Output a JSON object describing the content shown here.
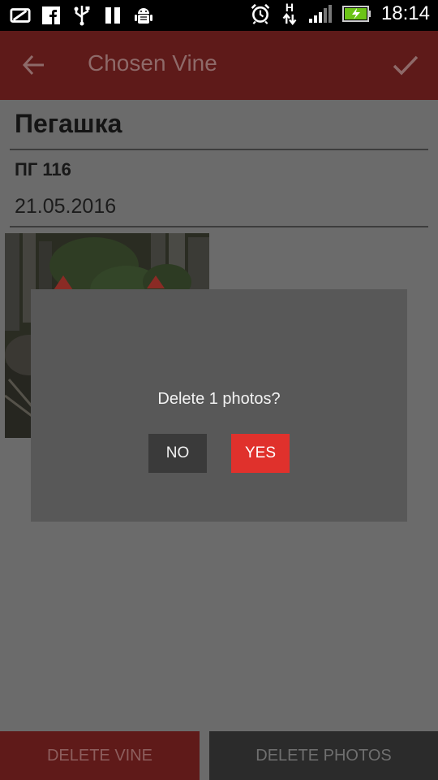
{
  "status_bar": {
    "time": "18:14",
    "network_letter": "H",
    "icons": [
      "screencast-icon",
      "facebook-icon",
      "usb-icon",
      "pause-icon",
      "android-debug-icon",
      "alarm-icon",
      "network-h-icon",
      "signal-icon",
      "battery-charging-icon"
    ]
  },
  "action_bar": {
    "title": "Chosen Vine",
    "back_icon": "arrow-left-icon",
    "confirm_icon": "check-icon",
    "background": "#5e1a19"
  },
  "vine": {
    "name": "Пегашка",
    "code": "ПГ 116",
    "date": "21.05.2016"
  },
  "dialog": {
    "message": "Delete 1 photos?",
    "no_label": "NO",
    "yes_label": "YES",
    "yes_color": "#e0312c"
  },
  "bottom_bar": {
    "delete_vine_label": "DELETE VINE",
    "delete_photos_label": "DELETE PHOTOS"
  }
}
